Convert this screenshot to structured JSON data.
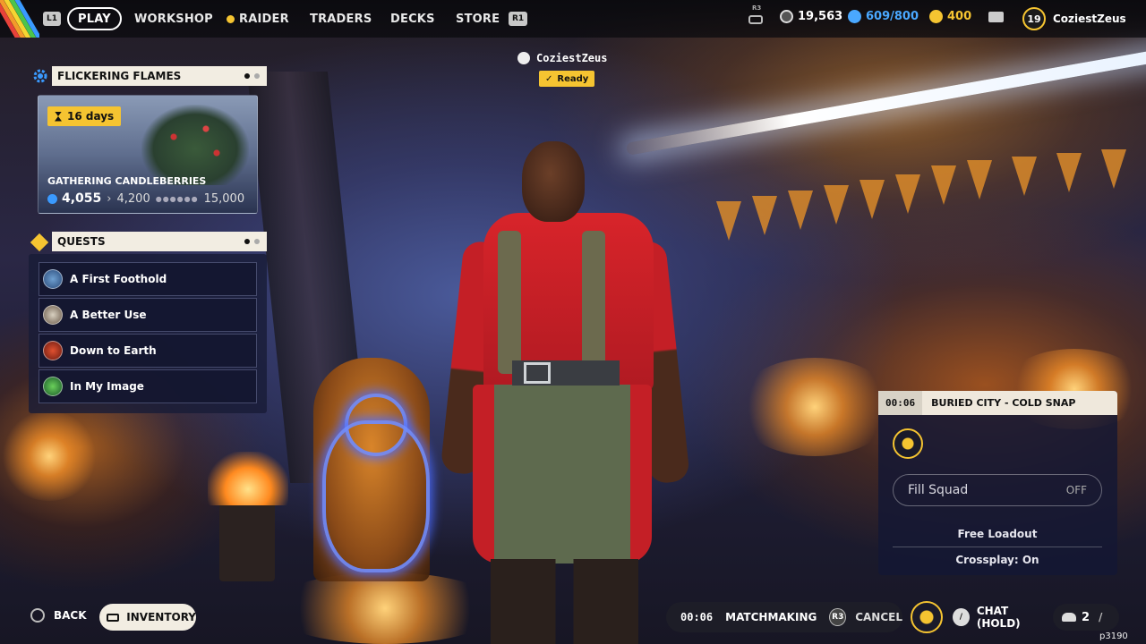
{
  "topbar": {
    "l1": "L1",
    "r1": "R1",
    "r3": "R3",
    "nav": [
      "PLAY",
      "WORKSHOP",
      "RAIDER",
      "TRADERS",
      "DECKS",
      "STORE"
    ],
    "currency_coins": "19,563",
    "currency_capacity": "609/800",
    "currency_tokens": "400",
    "level": "19",
    "username": "CoziestZeus"
  },
  "event": {
    "title": "FLICKERING FLAMES",
    "days_left": "16 days",
    "activity": "GATHERING CANDLEBERRIES",
    "current": "4,055",
    "next_milestone": "4,200",
    "max": "15,000"
  },
  "quests": {
    "title": "QUESTS",
    "items": [
      "A First Foothold",
      "A Better Use",
      "Down to Earth",
      "In My Image"
    ]
  },
  "squad_member": {
    "name": "CoziestZeus",
    "status": "Ready"
  },
  "match": {
    "timer": "00:06",
    "map": "BURIED CITY - COLD SNAP",
    "fill_squad_label": "Fill Squad",
    "fill_squad_value": "OFF",
    "loadout": "Free Loadout",
    "crossplay": "Crossplay: On"
  },
  "bottombar": {
    "back": "BACK",
    "inventory": "INVENTORY",
    "timer": "00:06",
    "matchmaking": "MATCHMAKING",
    "r3": "R3",
    "cancel": "CANCEL",
    "chat": "CHAT (HOLD)",
    "party_count": "2",
    "build": "p3190"
  },
  "colors": {
    "accent_yellow": "#f5c431",
    "panel_cream": "#f2ede2",
    "capacity_blue": "#4aa8ff",
    "event_blue": "#3a9aff"
  },
  "icons": {
    "event": "gear-icon",
    "quests": "diamond-quest-icon",
    "timer": "hourglass-icon",
    "inbox": "envelope-icon",
    "back": "circle-button-icon",
    "inventory": "touchpad-icon"
  }
}
